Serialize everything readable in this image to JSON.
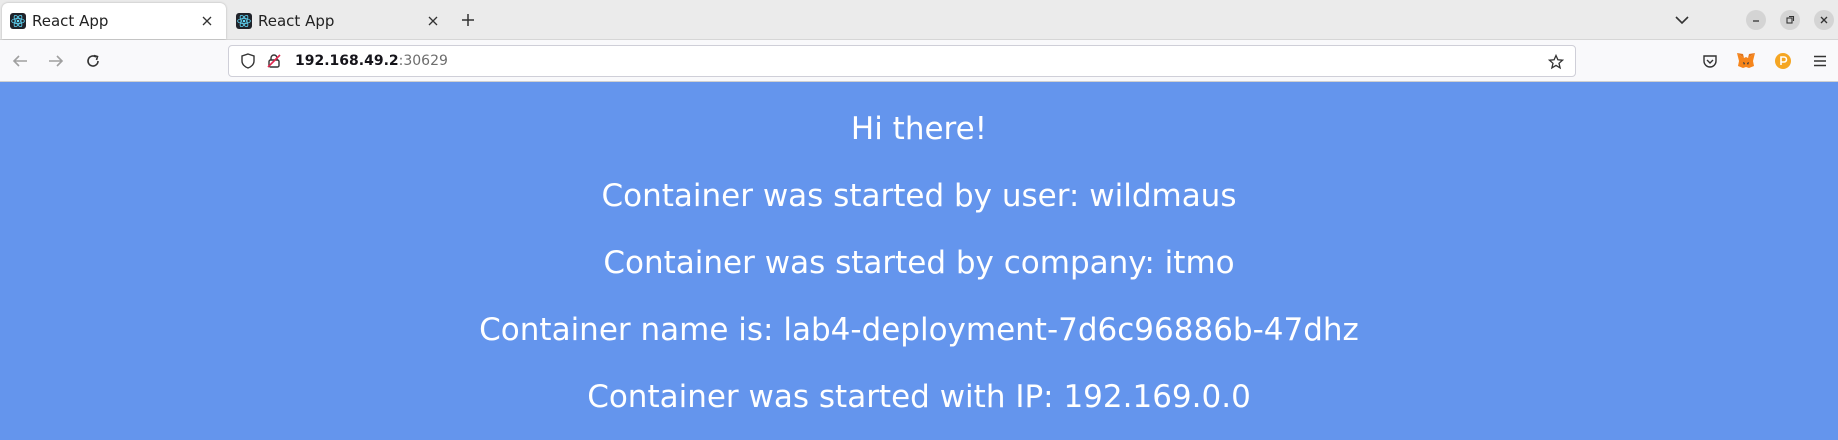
{
  "tabs": [
    {
      "title": "React App",
      "active": true
    },
    {
      "title": "React App",
      "active": false
    }
  ],
  "address_bar": {
    "host": "192.168.49.2",
    "port": ":30629"
  },
  "page": {
    "greeting": "Hi there!",
    "user_line": "Container was started by user: wildmaus",
    "company_line": "Container was started by company: itmo",
    "name_line": "Container name is: lab4-deployment-7d6c96886b-47dhz",
    "ip_line": "Container was started with IP: 192.169.0.0"
  },
  "colors": {
    "page_background": "#6495ed",
    "text": "#ffffff"
  },
  "icons": [
    "react-favicon",
    "close-icon",
    "plus-icon",
    "chevron-down-icon",
    "minimize-icon",
    "restore-icon",
    "window-close-icon",
    "back-arrow-icon",
    "forward-arrow-icon",
    "reload-icon",
    "shield-icon",
    "insecure-lock-icon",
    "star-icon",
    "pocket-icon",
    "metamask-fox-icon",
    "extension-icon",
    "menu-icon"
  ]
}
